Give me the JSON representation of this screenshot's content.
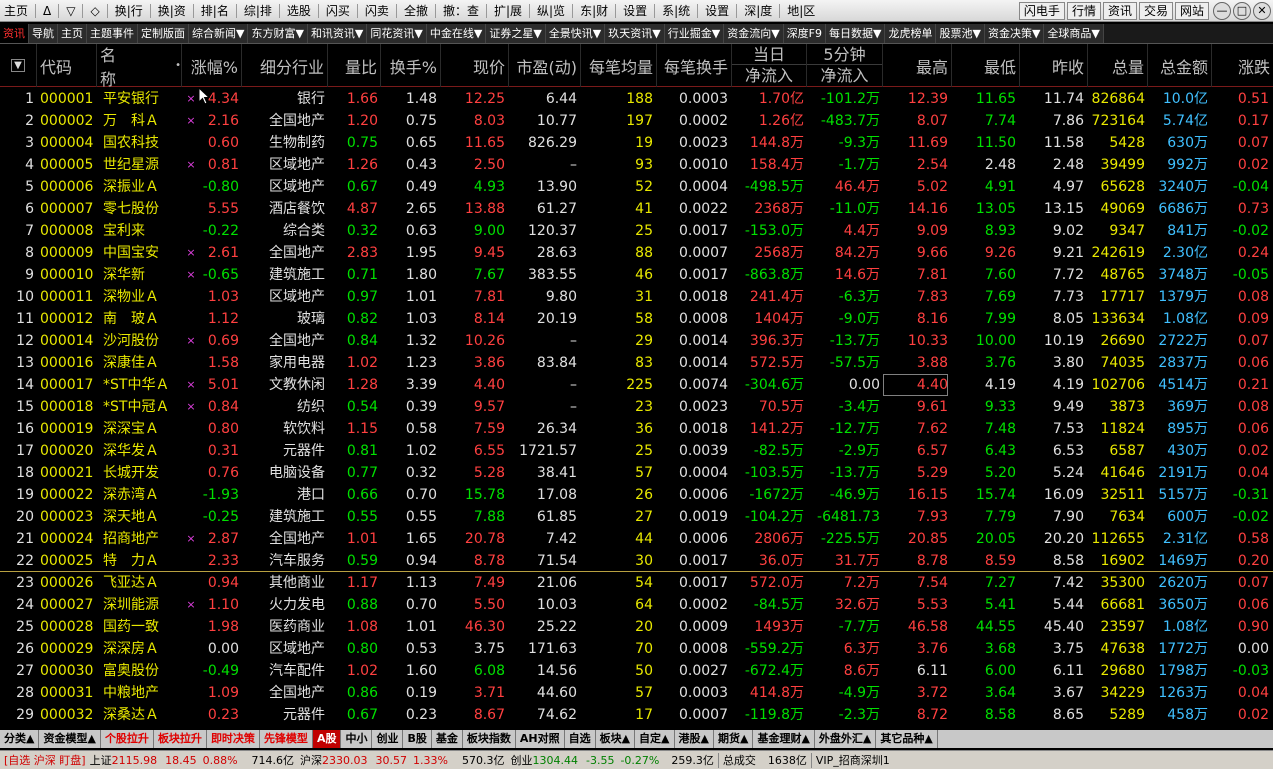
{
  "menu": {
    "items": [
      "主页",
      "Δ",
      "▽",
      "◇",
      "换|行",
      "换|资",
      "排|名",
      "综|排",
      "选股",
      "闪买",
      "闪卖",
      "全撤",
      "撤：查",
      "扩|展",
      "纵|览",
      "东|财",
      "设置",
      "系|统",
      "设置",
      "深|度",
      "地|区"
    ],
    "right_buttons": [
      "闪电手",
      "行情",
      "资讯",
      "交易",
      "网站"
    ],
    "window_controls": [
      "—",
      "□",
      "✕"
    ]
  },
  "tabs": [
    "资讯",
    "导航",
    "主页",
    "主题事件",
    "定制版面",
    "综合新闻▼",
    "东方财富▼",
    "和讯资讯▼",
    "同花资讯▼",
    "中金在线▼",
    "证券之星▼",
    "全景快讯▼",
    "玖天资讯▼",
    "行业掘金▼",
    "资金流向▼",
    "深度F9",
    "每日数据▼",
    "龙虎榜单",
    "股票池▼",
    "资金决策▼",
    "全球商品▼"
  ],
  "active_tab": "资讯",
  "columns": {
    "sort": "▼",
    "code": "代码",
    "name": "名称",
    "dot": "•",
    "pct": "涨幅%",
    "industry": "细分行业",
    "vol_ratio": "量比",
    "turnover": "换手%",
    "price": "现价",
    "pe": "市盈(动)",
    "avg_qty": "每笔均量",
    "avg_turn": "每笔换手",
    "today_top": "当日",
    "today_bot": "净流入",
    "min5_top": "5分钟",
    "min5_bot": "净流入",
    "high": "最高",
    "low": "最低",
    "prev": "昨收",
    "total_vol": "总量",
    "total_amt": "总金额",
    "change": "涨跌"
  },
  "rows": [
    {
      "no": "1",
      "code": "000001",
      "name": "平安银行",
      "mark": "×",
      "pct": "4.34",
      "ind": "银行",
      "vr": "1.66",
      "tr": "1.48",
      "price": "12.25",
      "pe": "6.44",
      "aq": "188",
      "at": "0.0003",
      "today": "1.70亿",
      "m5": "-101.2万",
      "high": "12.39",
      "low": "11.65",
      "prev": "11.74",
      "vol": "826864",
      "amt": "10.0亿",
      "chg": "0.51"
    },
    {
      "no": "2",
      "code": "000002",
      "name": "万　科Ａ",
      "mark": "×",
      "pct": "2.16",
      "ind": "全国地产",
      "vr": "1.20",
      "tr": "0.75",
      "price": "8.03",
      "pe": "10.77",
      "aq": "197",
      "at": "0.0002",
      "today": "1.26亿",
      "m5": "-483.7万",
      "high": "8.07",
      "low": "7.74",
      "prev": "7.86",
      "vol": "723164",
      "amt": "5.74亿",
      "chg": "0.17"
    },
    {
      "no": "3",
      "code": "000004",
      "name": "国农科技",
      "mark": "",
      "pct": "0.60",
      "ind": "生物制药",
      "vr": "0.75",
      "tr": "0.65",
      "price": "11.65",
      "pe": "826.29",
      "aq": "19",
      "at": "0.0023",
      "today": "144.8万",
      "m5": "-9.3万",
      "high": "11.69",
      "low": "11.50",
      "prev": "11.58",
      "vol": "5428",
      "amt": "630万",
      "chg": "0.07"
    },
    {
      "no": "4",
      "code": "000005",
      "name": "世纪星源",
      "mark": "×",
      "pct": "0.81",
      "ind": "区域地产",
      "vr": "1.26",
      "tr": "0.43",
      "price": "2.50",
      "pe": "–",
      "aq": "93",
      "at": "0.0010",
      "today": "158.4万",
      "m5": "-1.7万",
      "high": "2.54",
      "low": "2.48",
      "prev": "2.48",
      "vol": "39499",
      "amt": "992万",
      "chg": "0.02"
    },
    {
      "no": "5",
      "code": "000006",
      "name": "深振业Ａ",
      "mark": "",
      "pct": "-0.80",
      "ind": "区域地产",
      "vr": "0.67",
      "tr": "0.49",
      "price": "4.93",
      "pe": "13.90",
      "aq": "52",
      "at": "0.0004",
      "today": "-498.5万",
      "m5": "46.4万",
      "high": "5.02",
      "low": "4.91",
      "prev": "4.97",
      "vol": "65628",
      "amt": "3240万",
      "chg": "-0.04"
    },
    {
      "no": "6",
      "code": "000007",
      "name": "零七股份",
      "mark": "",
      "pct": "5.55",
      "ind": "酒店餐饮",
      "vr": "4.87",
      "tr": "2.65",
      "price": "13.88",
      "pe": "61.27",
      "aq": "41",
      "at": "0.0022",
      "today": "2368万",
      "m5": "-11.0万",
      "high": "14.16",
      "low": "13.05",
      "prev": "13.15",
      "vol": "49069",
      "amt": "6686万",
      "chg": "0.73"
    },
    {
      "no": "7",
      "code": "000008",
      "name": "宝利来",
      "mark": "",
      "pct": "-0.22",
      "ind": "综合类",
      "vr": "0.32",
      "tr": "0.63",
      "price": "9.00",
      "pe": "120.37",
      "aq": "25",
      "at": "0.0017",
      "today": "-153.0万",
      "m5": "4.4万",
      "high": "9.09",
      "low": "8.93",
      "prev": "9.02",
      "vol": "9347",
      "amt": "841万",
      "chg": "-0.02"
    },
    {
      "no": "8",
      "code": "000009",
      "name": "中国宝安",
      "mark": "×",
      "pct": "2.61",
      "ind": "全国地产",
      "vr": "2.83",
      "tr": "1.95",
      "price": "9.45",
      "pe": "28.63",
      "aq": "88",
      "at": "0.0007",
      "today": "2568万",
      "m5": "84.2万",
      "high": "9.66",
      "low": "9.26",
      "prev": "9.21",
      "vol": "242619",
      "amt": "2.30亿",
      "chg": "0.24"
    },
    {
      "no": "9",
      "code": "000010",
      "name": "深华新",
      "mark": "×",
      "pct": "-0.65",
      "ind": "建筑施工",
      "vr": "0.71",
      "tr": "1.80",
      "price": "7.67",
      "pe": "383.55",
      "aq": "46",
      "at": "0.0017",
      "today": "-863.8万",
      "m5": "14.6万",
      "high": "7.81",
      "low": "7.60",
      "prev": "7.72",
      "vol": "48765",
      "amt": "3748万",
      "chg": "-0.05"
    },
    {
      "no": "10",
      "code": "000011",
      "name": "深物业Ａ",
      "mark": "",
      "pct": "1.03",
      "ind": "区域地产",
      "vr": "0.97",
      "tr": "1.01",
      "price": "7.81",
      "pe": "9.80",
      "aq": "31",
      "at": "0.0018",
      "today": "241.4万",
      "m5": "-6.3万",
      "high": "7.83",
      "low": "7.69",
      "prev": "7.73",
      "vol": "17717",
      "amt": "1379万",
      "chg": "0.08"
    },
    {
      "no": "11",
      "code": "000012",
      "name": "南　玻Ａ",
      "mark": "",
      "pct": "1.12",
      "ind": "玻璃",
      "vr": "0.82",
      "tr": "1.03",
      "price": "8.14",
      "pe": "20.19",
      "aq": "58",
      "at": "0.0008",
      "today": "1404万",
      "m5": "-9.0万",
      "high": "8.16",
      "low": "7.99",
      "prev": "8.05",
      "vol": "133634",
      "amt": "1.08亿",
      "chg": "0.09"
    },
    {
      "no": "12",
      "code": "000014",
      "name": "沙河股份",
      "mark": "×",
      "pct": "0.69",
      "ind": "全国地产",
      "vr": "0.84",
      "tr": "1.32",
      "price": "10.26",
      "pe": "–",
      "aq": "29",
      "at": "0.0014",
      "today": "396.3万",
      "m5": "-13.7万",
      "high": "10.33",
      "low": "10.00",
      "prev": "10.19",
      "vol": "26690",
      "amt": "2722万",
      "chg": "0.07"
    },
    {
      "no": "13",
      "code": "000016",
      "name": "深康佳Ａ",
      "mark": "",
      "pct": "1.58",
      "ind": "家用电器",
      "vr": "1.02",
      "tr": "1.23",
      "price": "3.86",
      "pe": "83.84",
      "aq": "83",
      "at": "0.0014",
      "today": "572.5万",
      "m5": "-57.5万",
      "high": "3.88",
      "low": "3.76",
      "prev": "3.80",
      "vol": "74035",
      "amt": "2837万",
      "chg": "0.06"
    },
    {
      "no": "14",
      "code": "000017",
      "name": "*ST中华Ａ",
      "mark": "×",
      "pct": "5.01",
      "ind": "文教休闲",
      "vr": "1.28",
      "tr": "3.39",
      "price": "4.40",
      "pe": "–",
      "aq": "225",
      "at": "0.0074",
      "today": "-304.6万",
      "m5": "0.00",
      "high": "4.40",
      "low": "4.19",
      "prev": "4.19",
      "vol": "102706",
      "amt": "4514万",
      "chg": "0.21"
    },
    {
      "no": "15",
      "code": "000018",
      "name": "*ST中冠Ａ",
      "mark": "×",
      "pct": "0.84",
      "ind": "纺织",
      "vr": "0.54",
      "tr": "0.39",
      "price": "9.57",
      "pe": "–",
      "aq": "23",
      "at": "0.0023",
      "today": "70.5万",
      "m5": "-3.4万",
      "high": "9.61",
      "low": "9.33",
      "prev": "9.49",
      "vol": "3873",
      "amt": "369万",
      "chg": "0.08"
    },
    {
      "no": "16",
      "code": "000019",
      "name": "深深宝Ａ",
      "mark": "",
      "pct": "0.80",
      "ind": "软饮料",
      "vr": "1.15",
      "tr": "0.58",
      "price": "7.59",
      "pe": "26.34",
      "aq": "36",
      "at": "0.0018",
      "today": "141.2万",
      "m5": "-12.7万",
      "high": "7.62",
      "low": "7.48",
      "prev": "7.53",
      "vol": "11824",
      "amt": "895万",
      "chg": "0.06"
    },
    {
      "no": "17",
      "code": "000020",
      "name": "深华发Ａ",
      "mark": "",
      "pct": "0.31",
      "ind": "元器件",
      "vr": "0.81",
      "tr": "1.02",
      "price": "6.55",
      "pe": "1721.57",
      "aq": "25",
      "at": "0.0039",
      "today": "-82.5万",
      "m5": "-2.9万",
      "high": "6.57",
      "low": "6.43",
      "prev": "6.53",
      "vol": "6587",
      "amt": "430万",
      "chg": "0.02"
    },
    {
      "no": "18",
      "code": "000021",
      "name": "长城开发",
      "mark": "",
      "pct": "0.76",
      "ind": "电脑设备",
      "vr": "0.77",
      "tr": "0.32",
      "price": "5.28",
      "pe": "38.41",
      "aq": "57",
      "at": "0.0004",
      "today": "-103.5万",
      "m5": "-13.7万",
      "high": "5.29",
      "low": "5.20",
      "prev": "5.24",
      "vol": "41646",
      "amt": "2191万",
      "chg": "0.04"
    },
    {
      "no": "19",
      "code": "000022",
      "name": "深赤湾Ａ",
      "mark": "",
      "pct": "-1.93",
      "ind": "港口",
      "vr": "0.66",
      "tr": "0.70",
      "price": "15.78",
      "pe": "17.08",
      "aq": "26",
      "at": "0.0006",
      "today": "-1672万",
      "m5": "-46.9万",
      "high": "16.15",
      "low": "15.74",
      "prev": "16.09",
      "vol": "32511",
      "amt": "5157万",
      "chg": "-0.31"
    },
    {
      "no": "20",
      "code": "000023",
      "name": "深天地Ａ",
      "mark": "",
      "pct": "-0.25",
      "ind": "建筑施工",
      "vr": "0.55",
      "tr": "0.55",
      "price": "7.88",
      "pe": "61.85",
      "aq": "27",
      "at": "0.0019",
      "today": "-104.2万",
      "m5": "-6481.73",
      "high": "7.93",
      "low": "7.79",
      "prev": "7.90",
      "vol": "7634",
      "amt": "600万",
      "chg": "-0.02"
    },
    {
      "no": "21",
      "code": "000024",
      "name": "招商地产",
      "mark": "×",
      "pct": "2.87",
      "ind": "全国地产",
      "vr": "1.01",
      "tr": "1.65",
      "price": "20.78",
      "pe": "7.42",
      "aq": "44",
      "at": "0.0006",
      "today": "2806万",
      "m5": "-225.5万",
      "high": "20.85",
      "low": "20.05",
      "prev": "20.20",
      "vol": "112655",
      "amt": "2.31亿",
      "chg": "0.58"
    },
    {
      "no": "22",
      "code": "000025",
      "name": "特　力Ａ",
      "mark": "",
      "pct": "2.33",
      "ind": "汽车服务",
      "vr": "0.59",
      "tr": "0.94",
      "price": "8.78",
      "pe": "71.54",
      "aq": "30",
      "at": "0.0017",
      "today": "36.0万",
      "m5": "31.7万",
      "high": "8.78",
      "low": "8.59",
      "prev": "8.58",
      "vol": "16902",
      "amt": "1469万",
      "chg": "0.20"
    },
    {
      "no": "23",
      "code": "000026",
      "name": "飞亚达Ａ",
      "mark": "",
      "pct": "0.94",
      "ind": "其他商业",
      "vr": "1.17",
      "tr": "1.13",
      "price": "7.49",
      "pe": "21.06",
      "aq": "54",
      "at": "0.0017",
      "today": "572.0万",
      "m5": "7.2万",
      "high": "7.54",
      "low": "7.27",
      "prev": "7.42",
      "vol": "35300",
      "amt": "2620万",
      "chg": "0.07"
    },
    {
      "no": "24",
      "code": "000027",
      "name": "深圳能源",
      "mark": "×",
      "pct": "1.10",
      "ind": "火力发电",
      "vr": "0.88",
      "tr": "0.70",
      "price": "5.50",
      "pe": "10.03",
      "aq": "64",
      "at": "0.0002",
      "today": "-84.5万",
      "m5": "32.6万",
      "high": "5.53",
      "low": "5.41",
      "prev": "5.44",
      "vol": "66681",
      "amt": "3650万",
      "chg": "0.06"
    },
    {
      "no": "25",
      "code": "000028",
      "name": "国药一致",
      "mark": "",
      "pct": "1.98",
      "ind": "医药商业",
      "vr": "1.08",
      "tr": "1.01",
      "price": "46.30",
      "pe": "25.22",
      "aq": "20",
      "at": "0.0009",
      "today": "1493万",
      "m5": "-7.7万",
      "high": "46.58",
      "low": "44.55",
      "prev": "45.40",
      "vol": "23597",
      "amt": "1.08亿",
      "chg": "0.90"
    },
    {
      "no": "26",
      "code": "000029",
      "name": "深深房Ａ",
      "mark": "",
      "pct": "0.00",
      "ind": "区域地产",
      "vr": "0.80",
      "tr": "0.53",
      "price": "3.75",
      "pe": "171.63",
      "aq": "70",
      "at": "0.0008",
      "today": "-559.2万",
      "m5": "6.3万",
      "high": "3.76",
      "low": "3.68",
      "prev": "3.75",
      "vol": "47638",
      "amt": "1772万",
      "chg": "0.00"
    },
    {
      "no": "27",
      "code": "000030",
      "name": "富奥股份",
      "mark": "",
      "pct": "-0.49",
      "ind": "汽车配件",
      "vr": "1.02",
      "tr": "1.60",
      "price": "6.08",
      "pe": "14.56",
      "aq": "50",
      "at": "0.0027",
      "today": "-672.4万",
      "m5": "8.6万",
      "high": "6.11",
      "low": "6.00",
      "prev": "6.11",
      "vol": "29680",
      "amt": "1798万",
      "chg": "-0.03"
    },
    {
      "no": "28",
      "code": "000031",
      "name": "中粮地产",
      "mark": "",
      "pct": "1.09",
      "ind": "全国地产",
      "vr": "0.86",
      "tr": "0.19",
      "price": "3.71",
      "pe": "44.60",
      "aq": "57",
      "at": "0.0003",
      "today": "414.8万",
      "m5": "-4.9万",
      "high": "3.72",
      "low": "3.64",
      "prev": "3.67",
      "vol": "34229",
      "amt": "1263万",
      "chg": "0.04"
    },
    {
      "no": "29",
      "code": "000032",
      "name": "深桑达Ａ",
      "mark": "",
      "pct": "0.23",
      "ind": "元器件",
      "vr": "0.67",
      "tr": "0.23",
      "price": "8.67",
      "pe": "74.62",
      "aq": "17",
      "at": "0.0007",
      "today": "-119.8万",
      "m5": "-2.3万",
      "high": "8.72",
      "low": "8.58",
      "prev": "8.65",
      "vol": "5289",
      "amt": "458万",
      "chg": "0.02"
    }
  ],
  "bottom_tabs": [
    "分类▲",
    "资金模型▲",
    "个股拉升",
    "板块拉升",
    "即时决策",
    "先锋模型",
    "A股",
    "中小",
    "创业",
    "B股",
    "基金",
    "板块指数",
    "AH对照",
    "自选",
    "板块▲",
    "自定▲",
    "港股▲",
    "期货▲",
    "基金理财▲",
    "外盘外汇▲",
    "其它品种▲"
  ],
  "bottom_active": "A股",
  "status": {
    "prefix": "[自选 沪深 盯盘]",
    "sh_label": "上证",
    "sh_val": "2115.98",
    "sh_chg": "18.45",
    "sh_pct": "0.88%",
    "sh_amt": "714.6亿",
    "sz_label": "沪深",
    "sz_val": "2330.03",
    "sz_chg": "30.57",
    "sz_pct": "1.33%",
    "sz_amt": "570.3亿",
    "cy_label": "创业",
    "cy_val": "1304.44",
    "cy_chg": "-3.55",
    "cy_pct": "-0.27%",
    "cy_amt": "259.3亿",
    "total_label": "总成交",
    "total_val": "1638亿",
    "vip": "VIP_招商深圳1"
  },
  "colors": {
    "up": "#ff4040",
    "down": "#00e000",
    "flat": "#e0e0e0",
    "volume": "#e8e800",
    "amount": "#40c0ff"
  }
}
